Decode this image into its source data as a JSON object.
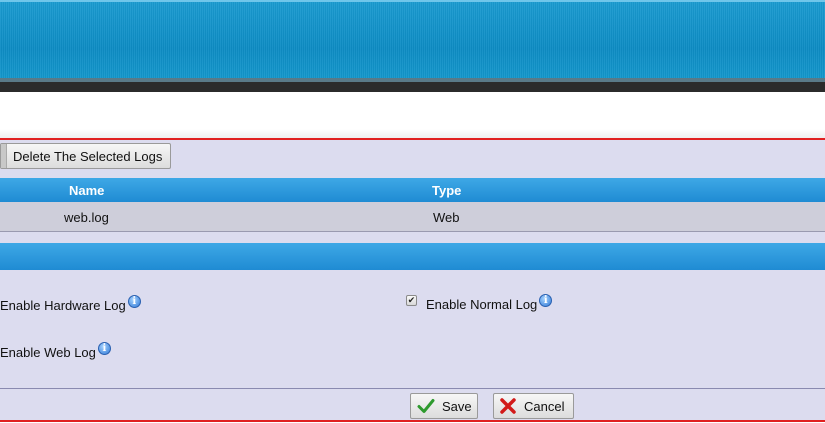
{
  "toolbar": {
    "delete_label": "Delete The Selected Logs"
  },
  "table": {
    "columns": [
      "Name",
      "Type"
    ],
    "rows": [
      {
        "name": "web.log",
        "type": "Web"
      }
    ]
  },
  "options": {
    "hardware_log": {
      "label": "Enable Hardware Log",
      "checked": false
    },
    "normal_log": {
      "label": "Enable Normal Log",
      "checked": true
    },
    "web_log": {
      "label": "Enable Web Log",
      "checked": false
    }
  },
  "footer": {
    "save_label": "Save",
    "cancel_label": "Cancel"
  },
  "colors": {
    "banner": "#0d8cc4",
    "header_blue": "#1f8bd3",
    "panel": "#dcdcef",
    "border_red": "#e02020"
  }
}
